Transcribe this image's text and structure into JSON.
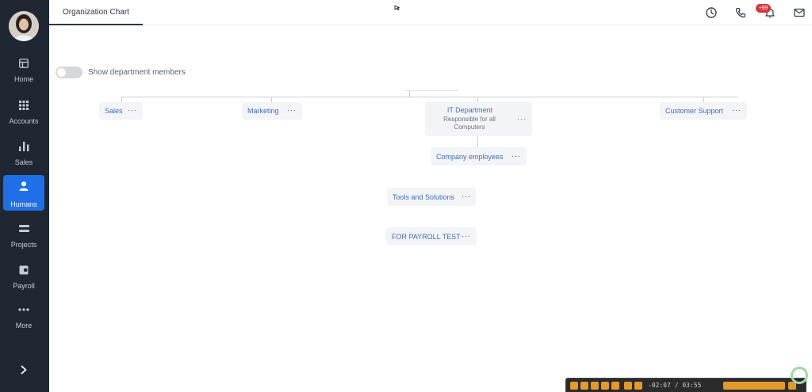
{
  "sidebar": {
    "items": [
      {
        "label": "Home",
        "icon": "home-icon"
      },
      {
        "label": "Accounts",
        "icon": "grid-icon"
      },
      {
        "label": "Sales",
        "icon": "bar-chart-icon"
      },
      {
        "label": "Humans",
        "icon": "person-icon",
        "active": true
      },
      {
        "label": "Projects",
        "icon": "projects-icon"
      },
      {
        "label": "Payroll",
        "icon": "wallet-icon"
      },
      {
        "label": "More",
        "icon": "more-icon"
      }
    ]
  },
  "topbar": {
    "tab_label": "Organization Chart",
    "notification_badge": "+99"
  },
  "toggle": {
    "label": "Show department members",
    "on": false
  },
  "org": {
    "sales": "Sales",
    "marketing": "Marketing",
    "it_department": "IT Department",
    "it_description": "Responsible for all Computers",
    "customer_support": "Customer Support",
    "company_employees": "Company employees",
    "tools_and_solutions": "Tools and Solutions",
    "payroll_test": "FOR PAYROLL TEST",
    "more_glyph": "···"
  },
  "player": {
    "time": "-02:07 / 03:55"
  },
  "colors": {
    "sidebar_bg": "#1f2733",
    "active_nav": "#1e6fe8",
    "node_text": "#3f6fb7",
    "badge": "#d8353c",
    "player_accent": "#e49a2a"
  }
}
